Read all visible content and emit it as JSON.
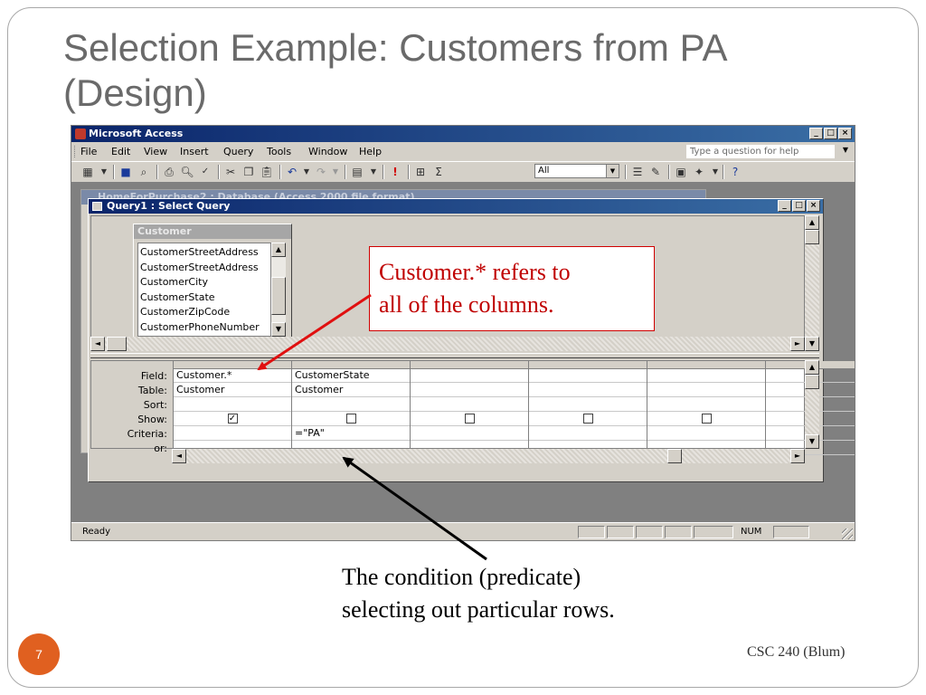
{
  "slide": {
    "title_line1": "Selection Example: Customers from PA",
    "title_line2": "(Design)",
    "number": "7",
    "footer": "CSC 240 (Blum)"
  },
  "app": {
    "title": "Microsoft Access",
    "menu": [
      "File",
      "Edit",
      "View",
      "Insert",
      "Query",
      "Tools",
      "Window",
      "Help"
    ],
    "help_placeholder": "Type a question for help",
    "toolbar_combo": "All",
    "db_window_title": "HomeForPurchase2 : Database (Access 2000 file format)",
    "query_window_title": "Query1 : Select Query",
    "status": "Ready",
    "status_num": "NUM"
  },
  "table": {
    "name": "Customer",
    "fields": [
      "CustomerStreetAddress",
      "CustomerStreetAddress",
      "CustomerCity",
      "CustomerState",
      "CustomerZipCode",
      "CustomerPhoneNumber"
    ]
  },
  "grid": {
    "row_labels": [
      "Field:",
      "Table:",
      "Sort:",
      "Show:",
      "Criteria:",
      "or:"
    ],
    "columns": [
      {
        "field": "Customer.*",
        "table": "Customer",
        "sort": "",
        "show": true,
        "criteria": "",
        "or": ""
      },
      {
        "field": "CustomerState",
        "table": "Customer",
        "sort": "",
        "show": false,
        "criteria": "=\"PA\"",
        "or": ""
      },
      {
        "field": "",
        "table": "",
        "sort": "",
        "show": false,
        "criteria": "",
        "or": ""
      },
      {
        "field": "",
        "table": "",
        "sort": "",
        "show": false,
        "criteria": "",
        "or": ""
      },
      {
        "field": "",
        "table": "",
        "sort": "",
        "show": false,
        "criteria": "",
        "or": ""
      },
      {
        "field": "",
        "table": "",
        "sort": "",
        "show": null,
        "criteria": "",
        "or": ""
      }
    ]
  },
  "callouts": {
    "top_line1": "Customer.* refers to",
    "top_line2": "all of the columns.",
    "bottom_line1": "The condition (predicate)",
    "bottom_line2": "selecting out particular rows."
  },
  "colors": {
    "title": "#6a6a6a",
    "callout_red": "#c00000",
    "slide_number_bg": "#e06020",
    "titlebar_blue": "#0a246a"
  }
}
